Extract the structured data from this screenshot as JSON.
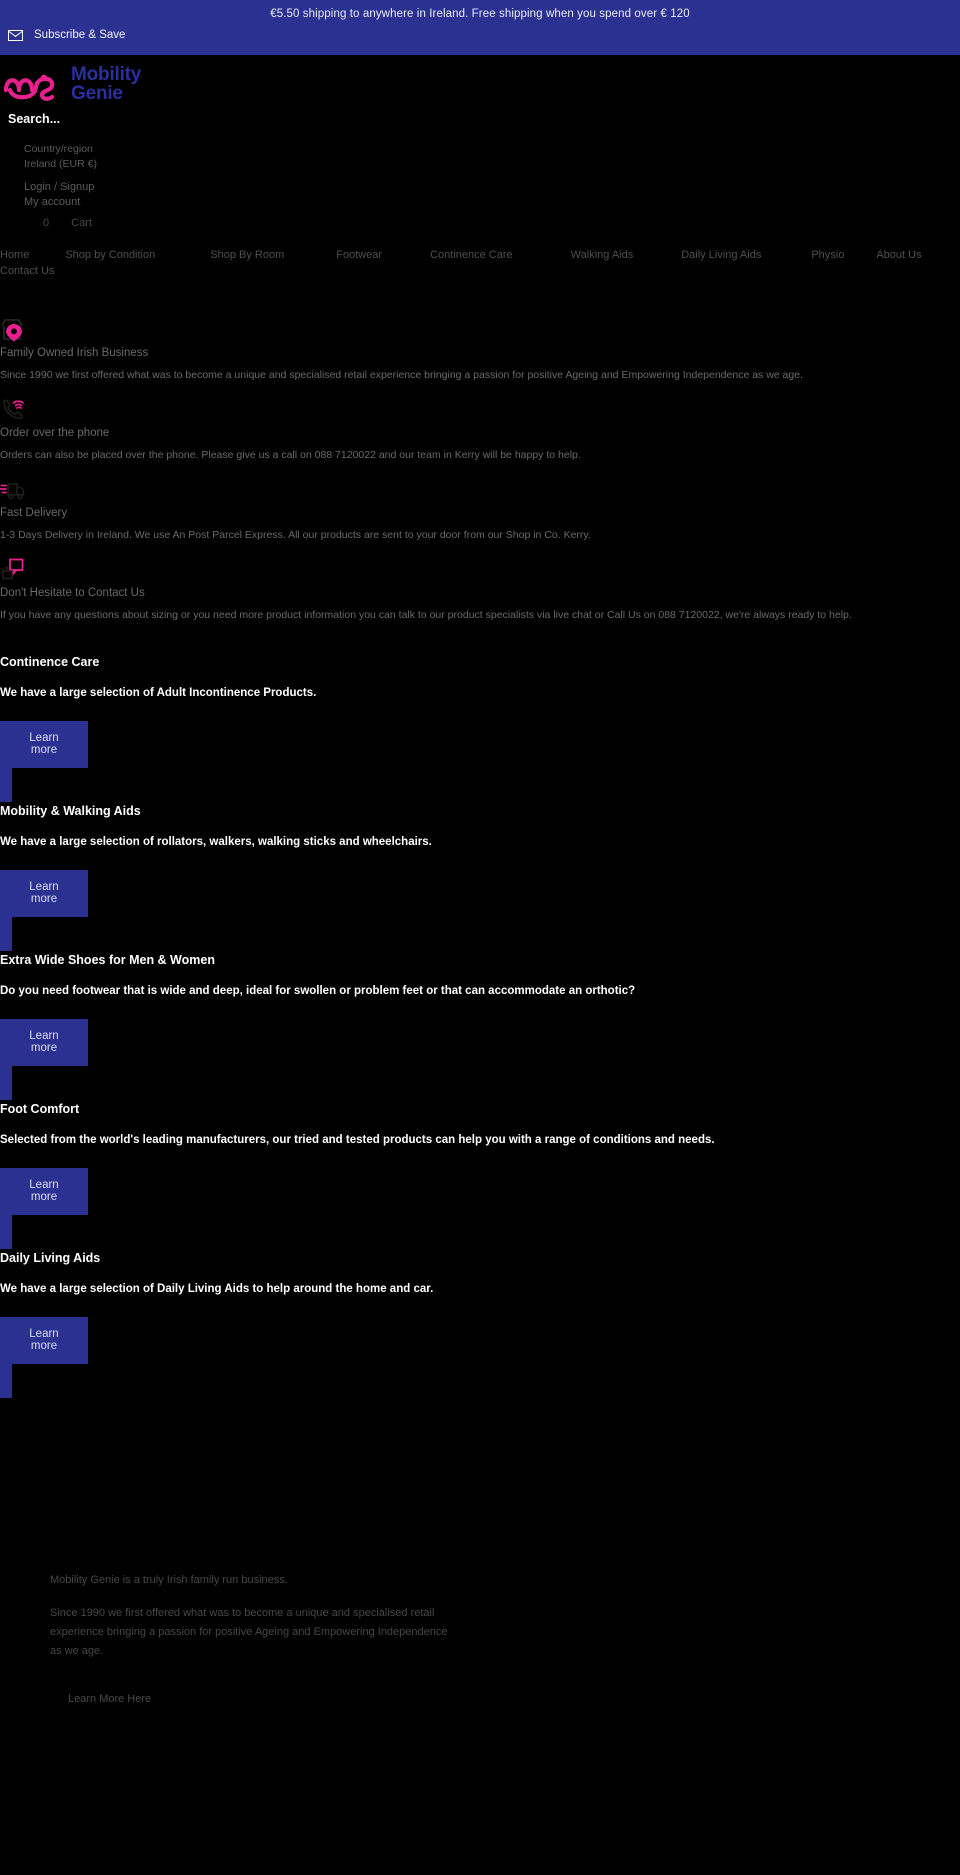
{
  "announcement": {
    "shipping_text": "€5.50 shipping to anywhere in Ireland. Free shipping when you spend over € 120",
    "subscribe_label": "Subscribe & Save",
    "bar_color": "#2b3190"
  },
  "header": {
    "logo": {
      "line1": "Mobility",
      "line2": "Genie",
      "mark_color": "#e8208e",
      "text_color": "#2b2f9e"
    },
    "search_placeholder": "Search...",
    "country_label": "Country/region",
    "country_value": "Ireland (EUR €)",
    "login_link": "Login / Signup",
    "account_link": "My account",
    "cart_count": "0",
    "cart_label": "Cart"
  },
  "nav": {
    "items": [
      {
        "label": "Home"
      },
      {
        "label": "Shop by Condition"
      },
      {
        "label": "Shop By Room"
      },
      {
        "label": "Footwear"
      },
      {
        "label": "Continence Care"
      },
      {
        "label": "Walking Aids"
      },
      {
        "label": "Daily Living Aids"
      },
      {
        "label": "Physio"
      },
      {
        "label": "About Us"
      }
    ],
    "contact_label": "Contact Us"
  },
  "features": [
    {
      "icon": "store-location-pin-icon",
      "title": "Family Owned Irish Business",
      "body": "Since 1990 we first offered what was to become a unique and  specialised retail experience bringing a  passion for positive Ageing and Empowering Independence as we age."
    },
    {
      "icon": "phone-ringing-icon",
      "title": "Order over the phone",
      "body": "Orders can also be placed over the phone. Please give us a call on 088 7120022 and our team in Kerry will be happy to help."
    },
    {
      "icon": "delivery-truck-icon",
      "title": "Fast Delivery",
      "body": "1-3 Days Delivery in Ireland. We use An Post Parcel Express. All our products are sent to your door from our Shop in Co. Kerry."
    },
    {
      "icon": "chat-bubble-icon",
      "title": "Don't Hesitate to Contact Us",
      "body": "If you have any questions about sizing or you need  more product information you can talk to our product specialists via live chat or Call Us on 088 7120022, we're always ready to help."
    }
  ],
  "collections": [
    {
      "title": "Continence Care",
      "description": "We have a large selection of Adult Incontinence Products.",
      "button": "Learn more"
    },
    {
      "title": "Mobility & Walking Aids",
      "description": "We have a large selection of rollators, walkers, walking sticks and wheelchairs.",
      "button": "Learn more"
    },
    {
      "title": "Extra Wide Shoes for Men & Women",
      "description": "Do you need footwear that is wide and deep, ideal for swollen or problem feet or that can accommodate an orthotic?",
      "button": "Learn more"
    },
    {
      "title": "Foot Comfort",
      "description": "Selected from the world's leading manufacturers, our tried and tested products can help you with a range of conditions and needs.",
      "button": "Learn more"
    },
    {
      "title": "Daily Living Aids",
      "description": "We have a large selection of Daily Living Aids to help around the home and car.",
      "button": "Learn more"
    }
  ],
  "footer_about": {
    "lead": "Mobility Genie is a truly Irish family run business.",
    "paragraph": "Since 1990 we first offered what was to become a unique and  specialised retail experience bringing a  passion for positive Ageing and Empowering Independence as we age.",
    "link": "Learn More Here"
  }
}
